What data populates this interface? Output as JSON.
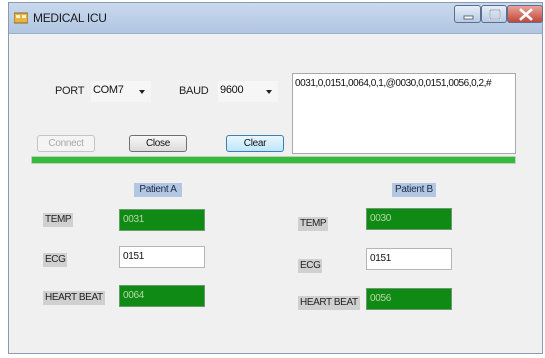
{
  "window": {
    "title": "MEDICAL ICU"
  },
  "port": {
    "label": "PORT",
    "value": "COM7"
  },
  "baud": {
    "label": "BAUD",
    "value": "9600"
  },
  "serial": {
    "text": "0031,0,0151,0064,0,1,@0030,0,0151,0056,0,2,#"
  },
  "buttons": {
    "connect": "Connect",
    "close": "Close",
    "clear": "Clear"
  },
  "progress": {
    "percent": 100,
    "color": "#2fbd3a"
  },
  "patient_a": {
    "title": "Patient A",
    "temp": {
      "label": "TEMP",
      "value": "0031"
    },
    "ecg": {
      "label": "ECG",
      "value": "0151"
    },
    "heart": {
      "label": "HEART BEAT",
      "value": "0064"
    }
  },
  "patient_b": {
    "title": "Patient B",
    "temp": {
      "label": "TEMP",
      "value": "0030"
    },
    "ecg": {
      "label": "ECG",
      "value": "0151"
    },
    "heart": {
      "label": "HEART BEAT",
      "value": "0056"
    }
  },
  "colors": {
    "value_green": "#0f8a14",
    "title_bar": "#b1c6e2",
    "patient_title_bg": "#b3c7e3"
  },
  "icons": [
    "app-icon",
    "minimize-icon",
    "maximize-icon",
    "close-icon",
    "chevron-down-icon"
  ]
}
